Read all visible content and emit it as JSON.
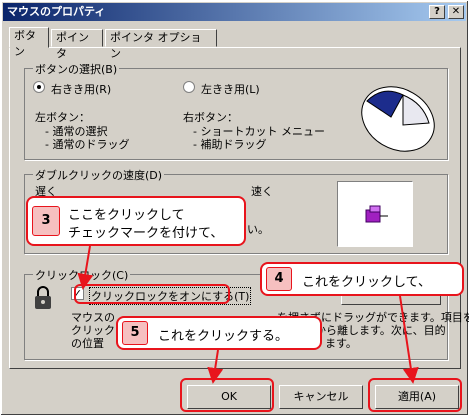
{
  "window": {
    "title": "マウスのプロパティ",
    "help_btn": "?",
    "close_btn": "✕"
  },
  "tabs": [
    "ボタン",
    "ポインタ",
    "ポインタ オプション"
  ],
  "buttons_group": {
    "title": "ボタンの選択(B)",
    "right_hand": "右きき用(R)",
    "left_hand": "左きき用(L)",
    "left_button_label": "左ボタン：",
    "left_items": [
      "- 通常の選択",
      "- 通常のドラッグ"
    ],
    "right_button_label": "右ボタン：",
    "right_items": [
      "- ショートカット メニュー",
      "- 補助ドラッグ"
    ]
  },
  "double_click_group": {
    "title": "ダブルクリックの速度(D)",
    "slow": "遅く",
    "fast": "速く",
    "partial_text": "い。"
  },
  "click_lock_group": {
    "title": "クリックロック(C)",
    "checkbox_label": "クリックロックをオンにする(T)",
    "checked": true,
    "desc_line1_a": "マウスの",
    "desc_line1_b": "を押さずにドラッグができます。項目を",
    "desc_line2_a": "クリック",
    "desc_line2_b": "から離します。次に、目的",
    "desc_line3_a": "の位置",
    "desc_line3_b": "ます。"
  },
  "footer": {
    "ok": "OK",
    "cancel": "キャンセル",
    "apply": "適用(A)"
  },
  "callouts": [
    {
      "num": "3",
      "line1": "ここをクリックして",
      "line2": "チェックマークを付けて、"
    },
    {
      "num": "4",
      "text": "これをクリックして、"
    },
    {
      "num": "5",
      "text": "これをクリックする。"
    }
  ]
}
